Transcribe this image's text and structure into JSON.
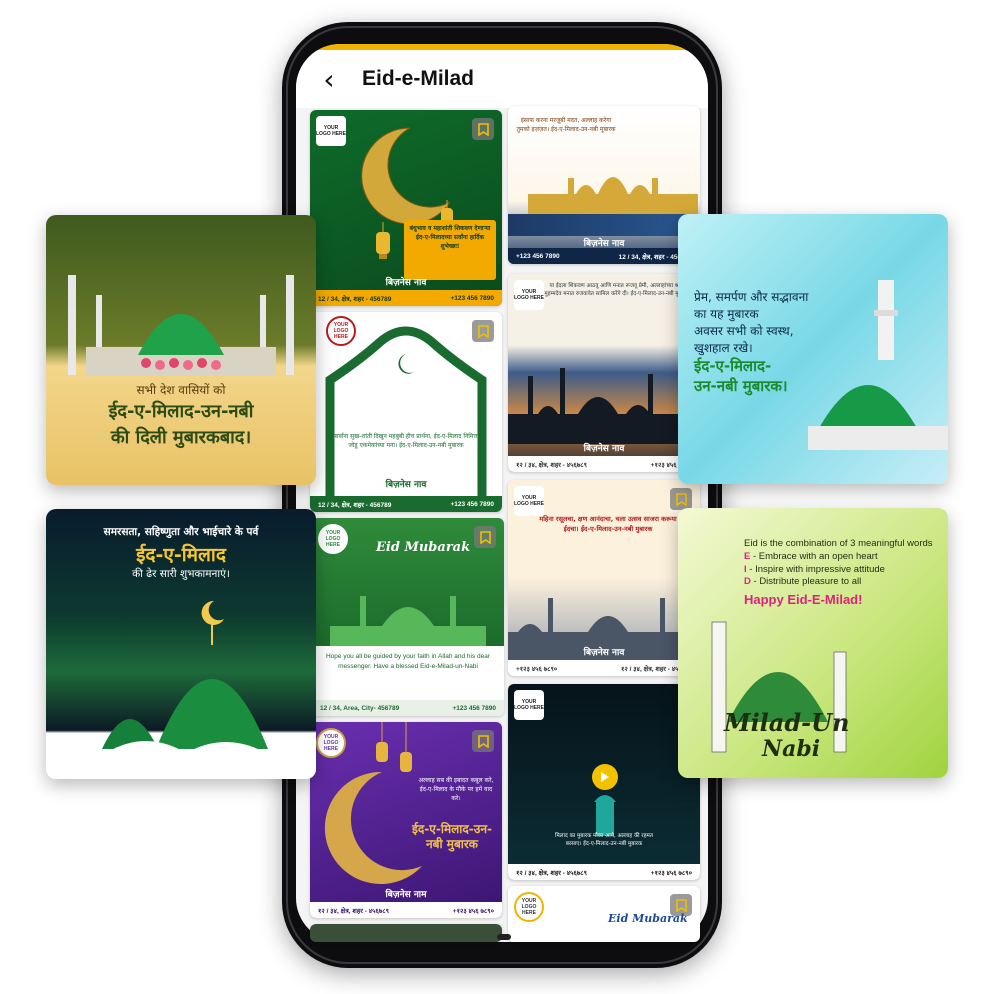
{
  "app": {
    "title": "Eid-e-Milad",
    "back_icon": "arrow-left-icon",
    "accent_color": "#f0b400"
  },
  "common": {
    "logo_text": "YOUR LOGO HERE",
    "business_name": "बिज़नेस नाव",
    "address": "12 / 34, क्षेत्र, शहर - 456789",
    "phone": "+123 456 7890",
    "address_marathi": "१२ / ३४, क्षेत्र, शहर - ४५६७८९",
    "phone_marathi": "+१२३ ४५६ ७८९०",
    "address_en": "12 / 34, Area, City- 456789",
    "business_name_alt": "बिज़नेस नाम"
  },
  "grid": {
    "t1": {
      "text": "बंधुभाव व महाशांती शिकवण देणाऱ्या ईद-ए-मिलादच्या सर्वांना हार्दिक शुभेच्छा!"
    },
    "t2": {
      "text": "इंसाफ करना मरज़ूबी मदत, अल्लाह करेगा तुमको इज़ज़त। ईद-ए-मिलाद-उन-नबी मुबारक"
    },
    "t3": {
      "text": "सर्वांना सुख-शांती दिखुन महबुबी हीच प्रार्थना, ईद-ए-मिलाद निमित्त जोडू एकमेकांच्या मना। ईद-ए-मिलाद-उन-नबी मुबारक"
    },
    "t4": {
      "text": "या ईदला शिकवण आठवू आणि मनात रूजवू प्रेमी, अल्लाहांच्या श्रद्धा मुहम्मदेव मनात रुजवावेत सामिल करेंगे दी। ईद-ए-मिलाद-उन-नबी मुबारक"
    },
    "t5": {
      "brand": "Eid Mubarak",
      "text": "Hope you all be guided by your faith in Allah and his dear messenger. Have a blessed Eid-e-Milad-un-Nabi"
    },
    "t6": {
      "text": "महिना रसूलचा, क्षण आनंदाचा, चला उत्सव साजरा करूया ईदचा। ईद-ए-मिलाद-उन-नबी मुबारक"
    },
    "t7": {
      "text": "अल्लाह सब की इबादत कबूल करे, ईद-ए-मिलाद के मौके पर हमें याद करे।",
      "headline": "ईद-ए-मिलाद-उन-नबी मुबारक"
    },
    "t8": {
      "text": "मिलाद का मुबारक मौका आये, अल्लाह की रहमत बरसाए। ईद-ए-मिलाद-उन-नबी मुबारक"
    },
    "t10": {
      "brand": "Eid Mubarak"
    }
  },
  "cards": {
    "left_top": {
      "line1": "सभी देश वासियों को",
      "line2": "ईद-ए-मिलाद-उन-नबी",
      "line3": "की दिली मुबारकबाद।"
    },
    "left_bottom": {
      "line1": "समरसता, सहिष्णुता और भाईचारे के पर्व",
      "line2": "ईद-ए-मिलाद",
      "line3": "की ढेर सारी शुभकामनाएं।"
    },
    "right_top": {
      "line1": "प्रेम, समर्पण और सद्भावना",
      "line2": "का यह मुबारक",
      "line3": "अवसर सभी को स्वस्थ,",
      "line4": "खुशहाल रखे।",
      "line5": "ईद-ए-मिलाद-",
      "line6": "उन-नबी मुबारक।"
    },
    "right_bottom": {
      "intro": "Eid is the combination of 3 meaningful words",
      "items": [
        {
          "letter": "E",
          "text": " - Embrace with an open heart"
        },
        {
          "letter": "I",
          "text": " - Inspire with impressive attitude"
        },
        {
          "letter": "D",
          "text": " - Distribute pleasure to all"
        }
      ],
      "headline": "Happy Eid-E-Milad!",
      "script_line1": "Milad-Un",
      "script_line2": "Nabi"
    }
  }
}
